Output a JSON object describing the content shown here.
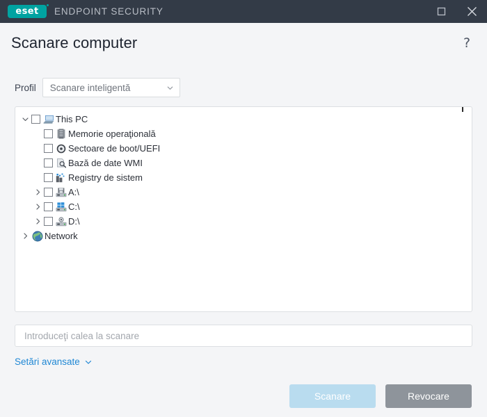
{
  "titlebar": {
    "logo_text": "eset",
    "product_name": "ENDPOINT SECURITY",
    "maximize_icon": "maximize-icon",
    "close_icon": "close-icon",
    "background_color": "#333b47",
    "logo_color": "#00a3a1"
  },
  "header": {
    "title": "Scanare computer",
    "help_label": "?"
  },
  "profile": {
    "label": "Profil",
    "selected": "Scanare inteligentă",
    "options": [
      "Scanare inteligentă"
    ]
  },
  "tree": {
    "nodes": [
      {
        "label": "This PC",
        "icon": "computer-icon",
        "level": 1,
        "expanded": true,
        "has_twisty": true,
        "has_checkbox": true,
        "checked": false
      },
      {
        "label": "Memorie operaţională",
        "icon": "memory-icon",
        "level": 2,
        "expanded": false,
        "has_twisty": false,
        "has_checkbox": true,
        "checked": false
      },
      {
        "label": "Sectoare de boot/UEFI",
        "icon": "disc-icon",
        "level": 2,
        "expanded": false,
        "has_twisty": false,
        "has_checkbox": true,
        "checked": false
      },
      {
        "label": "Bază de date WMI",
        "icon": "wmi-database-icon",
        "level": 2,
        "expanded": false,
        "has_twisty": false,
        "has_checkbox": true,
        "checked": false
      },
      {
        "label": "Registry de sistem",
        "icon": "registry-icon",
        "level": 2,
        "expanded": false,
        "has_twisty": false,
        "has_checkbox": true,
        "checked": false
      },
      {
        "label": "A:\\",
        "icon": "floppy-drive-icon",
        "level": 2,
        "expanded": false,
        "has_twisty": true,
        "has_checkbox": true,
        "checked": false
      },
      {
        "label": "C:\\",
        "icon": "system-drive-icon",
        "level": 2,
        "expanded": false,
        "has_twisty": true,
        "has_checkbox": true,
        "checked": false
      },
      {
        "label": "D:\\",
        "icon": "optical-drive-icon",
        "level": 2,
        "expanded": false,
        "has_twisty": true,
        "has_checkbox": true,
        "checked": false
      },
      {
        "label": "Network",
        "icon": "network-globe-icon",
        "level": 1,
        "expanded": false,
        "has_twisty": true,
        "has_checkbox": false,
        "checked": false
      }
    ]
  },
  "path_input": {
    "value": "",
    "placeholder": "Introduceţi calea la scanare"
  },
  "advanced": {
    "label": "Setări avansate",
    "chevron_icon": "chevron-down-icon",
    "color": "#1f87d4"
  },
  "footer": {
    "scan_label": "Scanare",
    "cancel_label": "Revocare",
    "scan_color": "#b9dcef",
    "cancel_color": "#8e949b"
  }
}
